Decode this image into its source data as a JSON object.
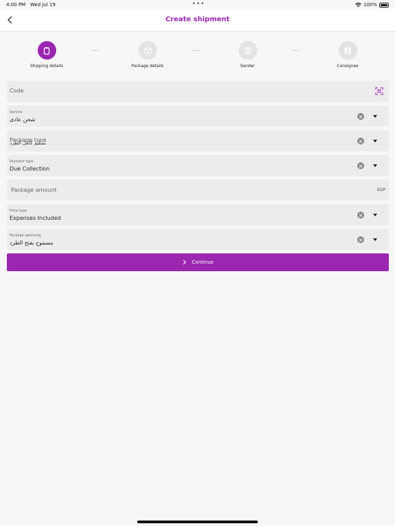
{
  "status_bar": {
    "time": "4:00 PM",
    "date": "Wed Jul 19",
    "more": "•••",
    "battery": "100%"
  },
  "nav": {
    "title": "Create shipment",
    "back_icon": "chevron-left-icon"
  },
  "stepper": {
    "steps": [
      {
        "label": "Shipping details",
        "icon": "clipboard-icon",
        "active": true
      },
      {
        "label": "Package details",
        "icon": "box-icon",
        "active": false
      },
      {
        "label": "Sender",
        "icon": "store-icon",
        "active": false
      },
      {
        "label": "Consignee",
        "icon": "user-badge-icon",
        "active": false
      }
    ],
    "separator": "---"
  },
  "form": {
    "code": {
      "placeholder": "Code",
      "icon": "qr-scan-icon"
    },
    "service": {
      "label": "Service",
      "value": "شحن عادى"
    },
    "package_type": {
      "label": "Package type",
      "value": "تسليم كامل الطرد"
    },
    "payment_type": {
      "label": "Payment type",
      "value": "Due Collection"
    },
    "package_amount": {
      "placeholder": "Package amount",
      "suffix": "EGP"
    },
    "price_type": {
      "label": "Price type",
      "value": "Expenses Included"
    },
    "package_opening": {
      "label": "Package openning",
      "value": "مسموح بفتح الطرد"
    }
  },
  "continue_button": {
    "label": "Continue",
    "icon": "chevron-right-icon"
  },
  "colors": {
    "accent": "#9b27b0",
    "field_bg": "#ececec",
    "page_bg": "#f7f7f7"
  }
}
